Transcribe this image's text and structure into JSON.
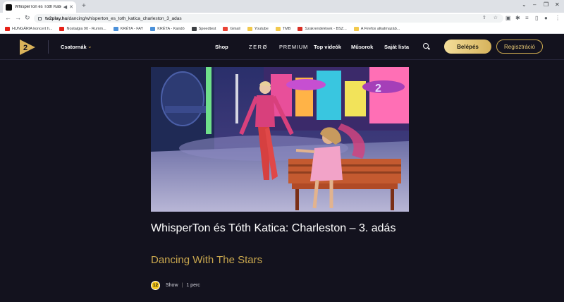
{
  "browser": {
    "tab_title": "WhisperTon és Tóth Katica: Ch",
    "url_host": "tv2play.hu",
    "url_path": "/dancing/whisperton_es_toth_katica_charleston_3_adas",
    "bookmarks": [
      {
        "label": "HUNGÁRIA koncert h...",
        "color": "#e62117"
      },
      {
        "label": "Nostalgia 90 - Rumm...",
        "color": "#e62117"
      },
      {
        "label": "KRÉTA - FAY",
        "color": "#4a90d9"
      },
      {
        "label": "KRÉTA - Kandó",
        "color": "#4a90d9"
      },
      {
        "label": "Speedtest",
        "color": "#3c4043"
      },
      {
        "label": "Gmail",
        "color": "#ea4335"
      },
      {
        "label": "Youtube",
        "color": "#f2c94c"
      },
      {
        "label": "TMB",
        "color": "#f2c94c"
      },
      {
        "label": "Szakrendelések - BSZ...",
        "color": "#d93025"
      },
      {
        "label": "A Firefox alkalmazáb...",
        "color": "#f2c94c"
      }
    ]
  },
  "header": {
    "channels_label": "Csatornák",
    "nav": [
      "Shop",
      "ZERØ",
      "PREMIUM",
      "Top videók",
      "Műsorok",
      "Saját lista"
    ],
    "login_label": "Belépés",
    "register_label": "Regisztráció"
  },
  "video": {
    "title": "WhisperTon és Tóth Katica: Charleston – 3. adás",
    "show": "Dancing With The Stars",
    "age_rating": "12",
    "category": "Show",
    "duration": "1 perc"
  },
  "colors": {
    "background": "#13121e",
    "accent_gold": "#c9a74e",
    "age_badge": "#f5c518"
  }
}
